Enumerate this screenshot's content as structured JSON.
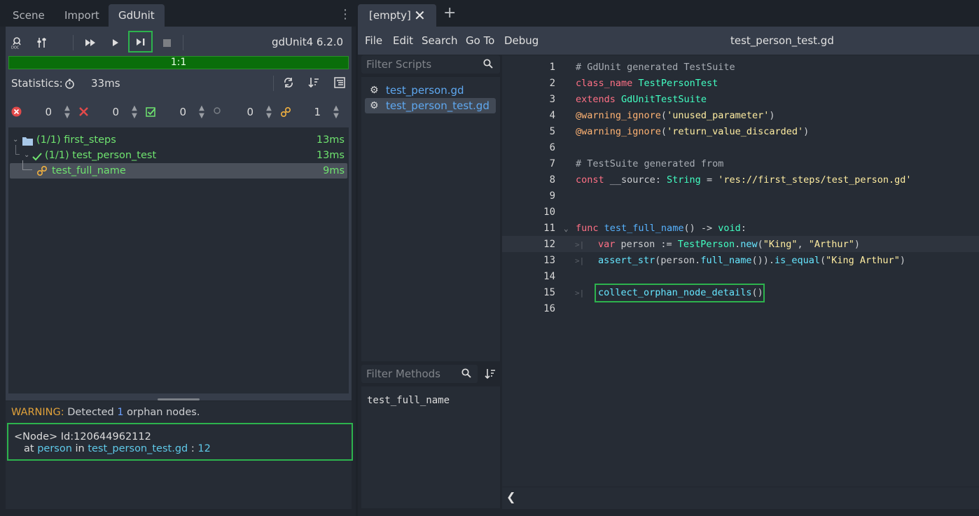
{
  "dock_tabs": [
    "Scene",
    "Import",
    "GdUnit"
  ],
  "gdunit": {
    "version": "gdUnit4 6.2.0",
    "progress": {
      "text": "1:1",
      "fraction": 1.0
    },
    "statistics_label": "Statistics:",
    "statistics_time": "33ms",
    "counters": [
      {
        "icon": "error-icon",
        "value": "0"
      },
      {
        "icon": "failure-icon",
        "value": "0"
      },
      {
        "icon": "passed-icon",
        "value": "0"
      },
      {
        "icon": "skipped-icon",
        "value": "0"
      },
      {
        "icon": "orphan-icon",
        "value": "1"
      }
    ],
    "tree": [
      {
        "label": "(1/1) first_steps",
        "time": "13ms"
      },
      {
        "label": "(1/1) test_person_test",
        "time": "13ms"
      },
      {
        "label": "test_full_name",
        "time": "9ms"
      }
    ],
    "report": {
      "warning_prefix": "WARNING:",
      "warning_mid": " Detected ",
      "warning_count": "1",
      "warning_suffix": " orphan nodes.",
      "node_tag": "<Node>",
      "node_id_label": " Id:",
      "node_id": "120644962112",
      "at_label": "at ",
      "var_name": "person",
      "in_label": " in ",
      "file": "test_person_test.gd",
      "line_sep": " : ",
      "line": "12"
    }
  },
  "editor": {
    "tab_label": "[empty]",
    "menu": [
      "File",
      "Edit",
      "Search",
      "Go To",
      "Debug"
    ],
    "file_title": "test_person_test.gd",
    "filter_scripts_placeholder": "Filter Scripts",
    "scripts": [
      "test_person.gd",
      "test_person_test.gd"
    ],
    "filter_methods_placeholder": "Filter Methods",
    "methods": [
      "test_full_name"
    ],
    "line_numbers": [
      "1",
      "2",
      "3",
      "4",
      "5",
      "6",
      "7",
      "8",
      "9",
      "10",
      "11",
      "12",
      "13",
      "14",
      "15",
      "16"
    ]
  },
  "colors": {
    "accent_green": "#2db34d",
    "progress_green": "#0a6e0a",
    "tree_green": "#6fe36f",
    "warning": "#e0a13a"
  }
}
